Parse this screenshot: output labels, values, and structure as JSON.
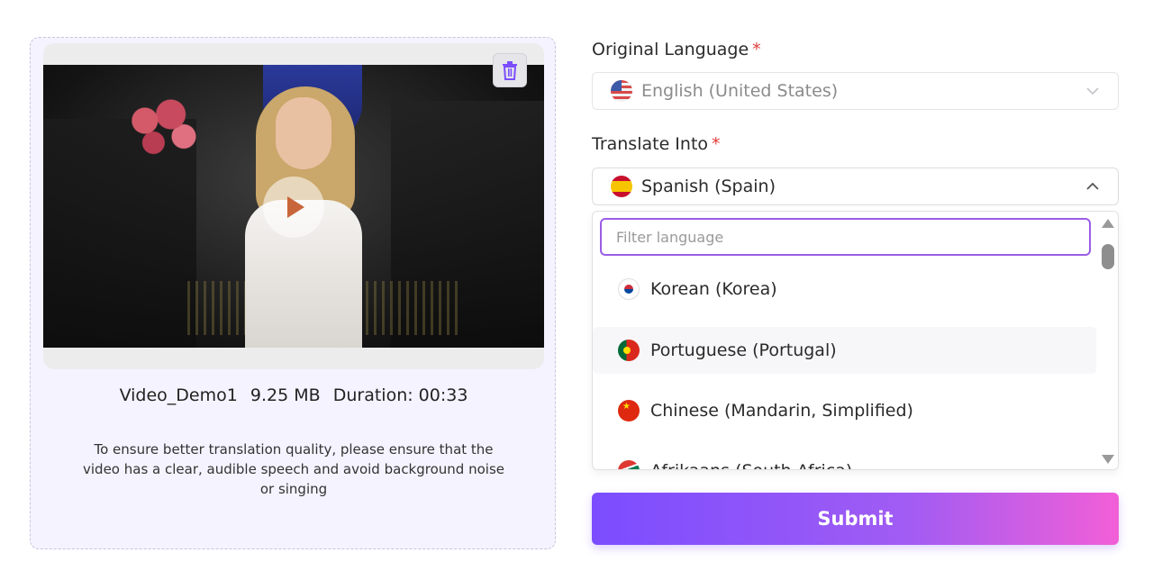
{
  "video": {
    "file_name": "Video_Demo1",
    "file_size": "9.25 MB",
    "duration": "Duration: 00:33",
    "hint": "To ensure better translation quality, please ensure that the video has a clear, audible speech and avoid background noise or singing"
  },
  "form": {
    "original_label": "Original Language",
    "required_mark": "*",
    "original_value": "English (United States)",
    "target_label": "Translate Into",
    "target_value": "Spanish (Spain)",
    "filter_placeholder": "Filter language",
    "filter_value": "",
    "options": [
      {
        "label": "Korean (Korea)",
        "flag": "flag-kr"
      },
      {
        "label": "Portuguese (Portugal)",
        "flag": "flag-pt"
      },
      {
        "label": "Chinese (Mandarin, Simplified)",
        "flag": "flag-cn"
      },
      {
        "label": "Afrikaans (South Africa)",
        "flag": "flag-za"
      }
    ],
    "submit_label": "Submit"
  },
  "icons": {
    "delete": "trash-icon",
    "play": "play-icon",
    "dropdown": "chevron-down-icon",
    "dropdown_open": "chevron-up-icon"
  },
  "colors": {
    "accent": "#9b5de5",
    "required": "#e23b3b",
    "submit_start": "#7b4dff",
    "submit_end": "#f25fd7"
  }
}
